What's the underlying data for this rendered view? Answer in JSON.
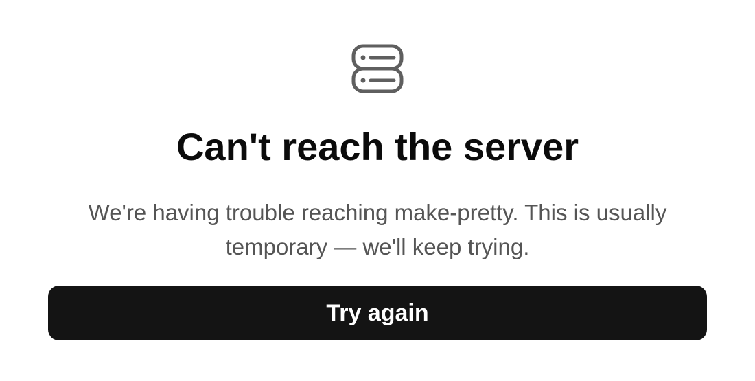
{
  "error": {
    "icon": "server-icon",
    "title": "Can't reach the server",
    "message": "We're having trouble reaching make-pretty. This is usually temporary — we'll keep trying.",
    "button_label": "Try again"
  },
  "colors": {
    "background": "#ffffff",
    "title": "#0b0b0b",
    "message": "#555555",
    "button_background": "#141414",
    "button_text": "#ffffff",
    "icon": "#5f5f5f"
  }
}
